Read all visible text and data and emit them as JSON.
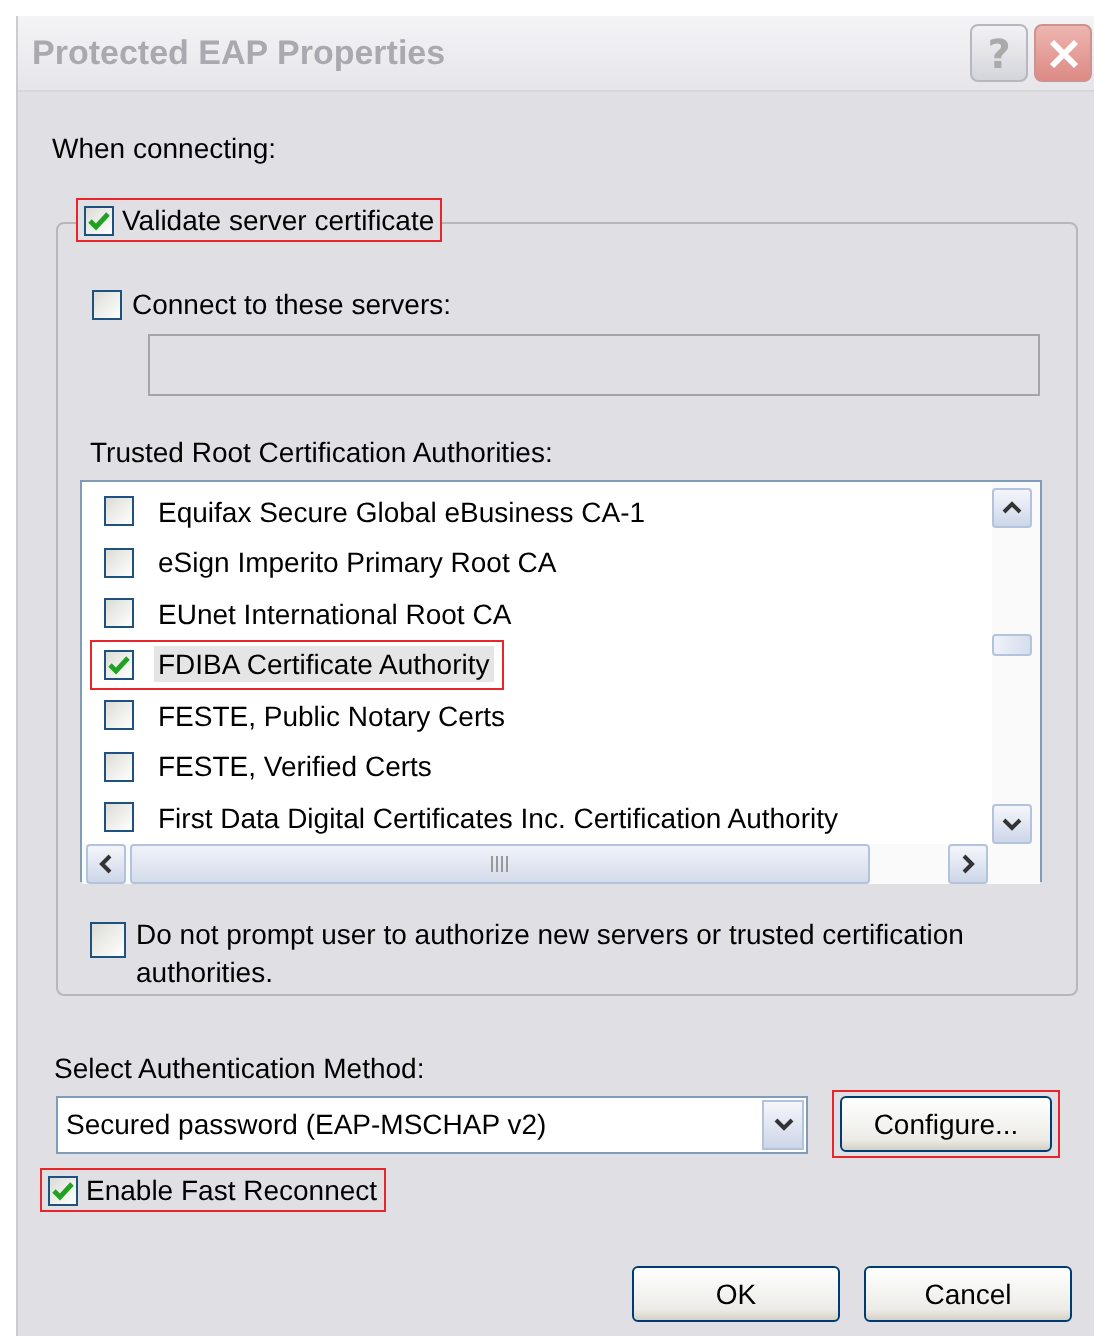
{
  "window": {
    "title": "Protected EAP Properties",
    "help": "?"
  },
  "when_connecting": {
    "label": "When connecting:"
  },
  "validate_certificate": {
    "label": "Validate server certificate",
    "checked": true,
    "highlighted": true
  },
  "connect_servers": {
    "label": "Connect to these servers:",
    "checked": false,
    "value_placeholder_shown": true
  },
  "trusted_roots": {
    "label": "Trusted Root Certification Authorities:",
    "items": [
      {
        "label": "Equifax Secure Global eBusiness CA-1",
        "checked": false,
        "highlighted": false
      },
      {
        "label": "eSign Imperito Primary Root CA",
        "checked": false,
        "highlighted": false
      },
      {
        "label": "EUnet International Root CA",
        "checked": false,
        "highlighted": false
      },
      {
        "label": "FDIBA Certificate Authority",
        "checked": true,
        "highlighted": true
      },
      {
        "label": "FESTE, Public Notary Certs",
        "checked": false,
        "highlighted": false
      },
      {
        "label": "FESTE, Verified Certs",
        "checked": false,
        "highlighted": false
      },
      {
        "label": "First Data Digital Certificates Inc. Certification Authority",
        "checked": false,
        "highlighted": false
      }
    ]
  },
  "do_not_prompt": {
    "label": "Do not prompt user to authorize new servers or trusted certification authorities.",
    "checked": false
  },
  "auth_method": {
    "label": "Select Authentication Method:",
    "value": "Secured password (EAP-MSCHAP v2)"
  },
  "configure_button": {
    "label": "Configure...",
    "highlighted": true
  },
  "fast_reconnect": {
    "label": "Enable Fast Reconnect",
    "checked": true,
    "highlighted": true
  },
  "buttons": [
    "OK",
    "Cancel"
  ]
}
